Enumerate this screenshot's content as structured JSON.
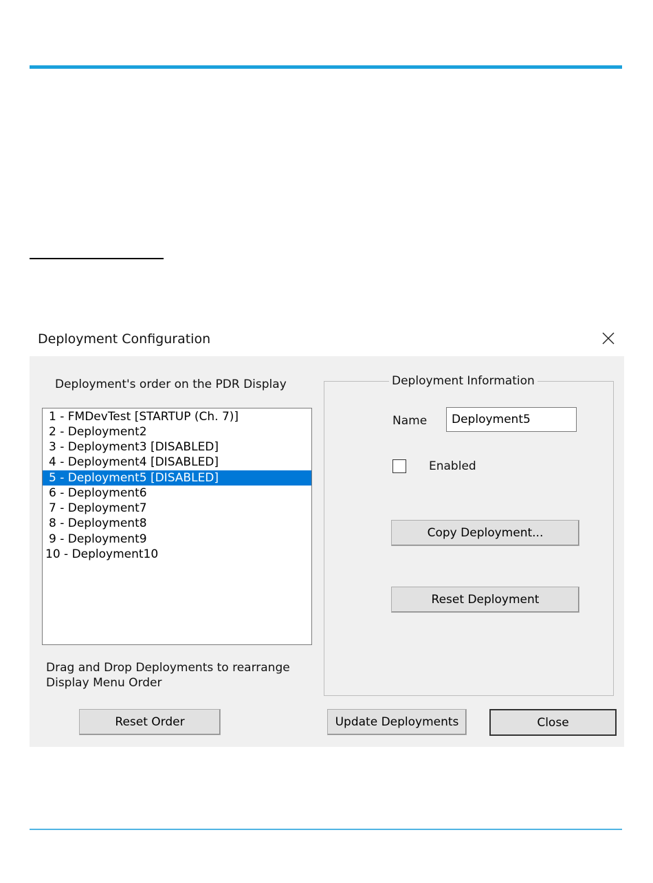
{
  "dialog": {
    "title": "Deployment Configuration",
    "close_icon": "close-icon"
  },
  "order_panel": {
    "heading": "Deployment's order on the PDR Display",
    "items": [
      "1 - FMDevTest [STARTUP (Ch. 7)]",
      "2 - Deployment2",
      "3 - Deployment3 [DISABLED]",
      "4 - Deployment4 [DISABLED]",
      "5 - Deployment5 [DISABLED]",
      "6 - Deployment6",
      "7 - Deployment7",
      "8 - Deployment8",
      "9 - Deployment9",
      "10 - Deployment10"
    ],
    "selected_index": 4,
    "hint_line1": "Drag and Drop Deployments to rearrange",
    "hint_line2": "Display Menu Order",
    "reset_order_label": "Reset Order"
  },
  "info_panel": {
    "legend": "Deployment Information",
    "name_label": "Name",
    "name_value": "Deployment5",
    "enabled_label": "Enabled",
    "enabled_checked": false,
    "copy_label": "Copy Deployment...",
    "reset_label": "Reset Deployment"
  },
  "footer": {
    "update_label": "Update Deployments",
    "close_label": "Close"
  },
  "colors": {
    "accent_rule": "#1ba1dc",
    "selection": "#0078d7",
    "dialog_bg": "#f0f0f0"
  }
}
